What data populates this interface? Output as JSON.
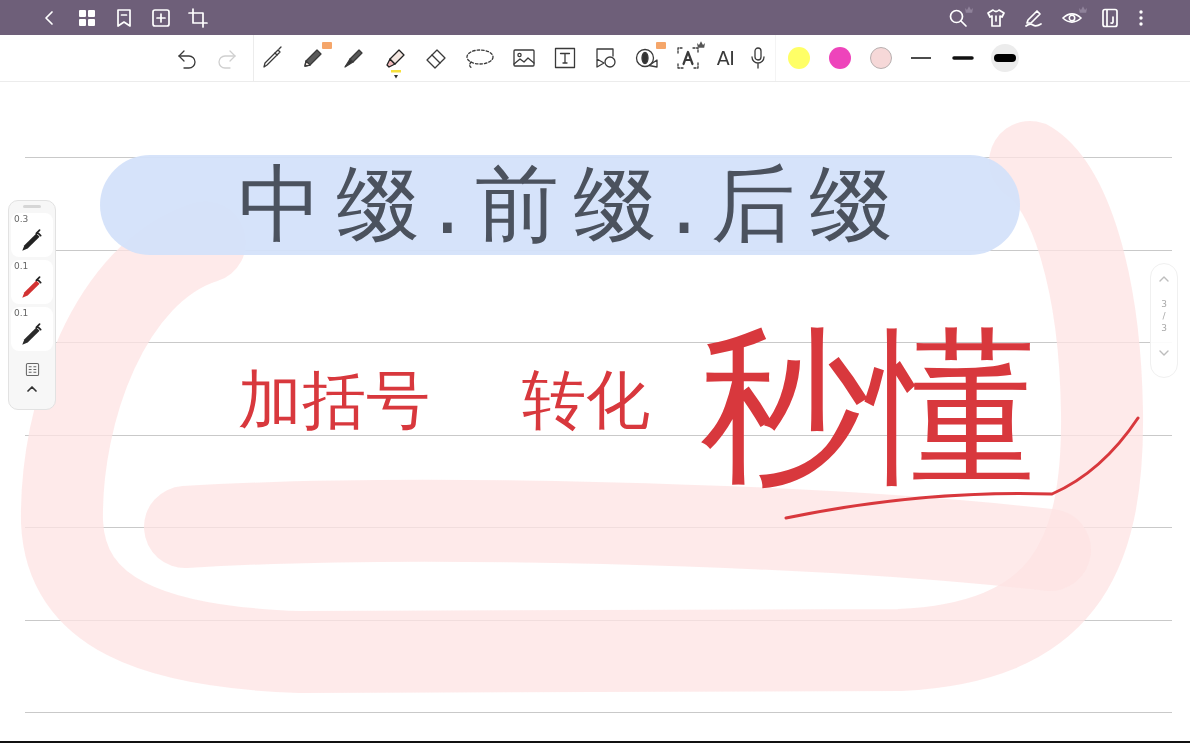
{
  "top_bar": {
    "left": [
      {
        "kind": "back"
      },
      {
        "kind": "grid"
      },
      {
        "kind": "bookmark"
      },
      {
        "kind": "add_page"
      },
      {
        "kind": "crop"
      }
    ],
    "right": [
      {
        "kind": "search",
        "premium": true
      },
      {
        "kind": "shirt",
        "premium": false
      },
      {
        "kind": "pen",
        "premium": false
      },
      {
        "kind": "eye",
        "premium": true
      },
      {
        "kind": "notebook",
        "premium": false
      },
      {
        "kind": "more",
        "premium": false
      }
    ]
  },
  "toolbar": {
    "history": [
      {
        "kind": "undo",
        "disabled": false
      },
      {
        "kind": "redo",
        "disabled": true
      }
    ],
    "tools": [
      {
        "kind": "pen",
        "selected": false,
        "badge": false,
        "premium": false
      },
      {
        "kind": "pencil",
        "selected": false,
        "badge": true,
        "premium": false
      },
      {
        "kind": "fountain_pen",
        "selected": false,
        "badge": false,
        "premium": false
      },
      {
        "kind": "highlighter",
        "selected": true,
        "badge": false,
        "premium": false
      },
      {
        "kind": "eraser",
        "selected": false,
        "badge": false,
        "premium": false
      },
      {
        "kind": "lasso",
        "selected": false,
        "badge": false,
        "premium": false
      },
      {
        "kind": "image",
        "selected": false,
        "badge": false,
        "premium": false
      },
      {
        "kind": "text_box",
        "selected": false,
        "badge": false,
        "premium": false
      },
      {
        "kind": "shape",
        "selected": false,
        "badge": false,
        "premium": false
      },
      {
        "kind": "tape",
        "selected": false,
        "badge": true,
        "premium": false
      },
      {
        "kind": "text_recognition",
        "selected": false,
        "badge": false,
        "premium": true
      },
      {
        "kind": "ai",
        "label": "AI",
        "selected": false,
        "badge": false,
        "premium": false
      },
      {
        "kind": "voice",
        "selected": false,
        "badge": false,
        "premium": false
      }
    ],
    "colors": [
      {
        "color": "#ffff66",
        "selected": false
      },
      {
        "color": "#ee44bb",
        "selected": false
      },
      {
        "color": "#f6d8d8",
        "selected": true
      }
    ],
    "stroke_widths": [
      {
        "kind": "thin",
        "selected": false
      },
      {
        "kind": "medium",
        "selected": false
      },
      {
        "kind": "thick",
        "selected": true
      }
    ]
  },
  "pen_panel": {
    "pens": [
      {
        "size": "0.3",
        "color": "#222222"
      },
      {
        "size": "0.1",
        "color": "#d23232"
      },
      {
        "size": "0.1",
        "color": "#2a2a2a"
      }
    ]
  },
  "page_indicator": {
    "current": "3",
    "separator": "/",
    "total": "3"
  },
  "page": {
    "ink": [
      {
        "kind": "title",
        "text": "中缀.前缀.后缀",
        "color": "#4b525e",
        "highlighted": true
      },
      {
        "kind": "note",
        "text": "加括号",
        "color": "#d8383d",
        "highlighted": false
      },
      {
        "kind": "note",
        "text": "转化",
        "color": "#d8383d",
        "highlighted": false
      },
      {
        "kind": "big",
        "text": "秒懂",
        "color": "#d8383d",
        "highlighted": false
      }
    ]
  }
}
